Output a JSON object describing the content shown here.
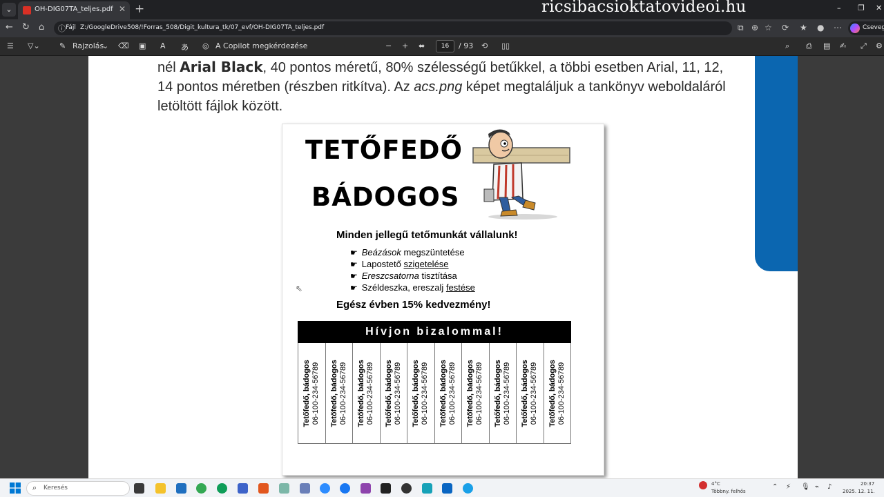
{
  "browser": {
    "tab_title": "OH-DIG07TA_teljes.pdf",
    "watermark": "ricsibacsioktatovideoi.hu",
    "url_scheme": "Fájl",
    "url_path": "Z:/GoogleDrive508/!Forras_508/Digit_kultura_tk/07_evf/OH-DIG07TA_teljes.pdf",
    "copilot_label": "Csevegés"
  },
  "pdf_toolbar": {
    "draw_label": "Rajzolás",
    "ask_copilot_label": "A Copilot megkérdezése",
    "page_current": "16",
    "page_total": "/ 93"
  },
  "document": {
    "para_lead": "nél ",
    "para_bold": "Arial Black",
    "para_mid": ", 40 pontos méretű, 80% szélességű betűkkel, a többi esetben Arial, 11, 12, 14 pontos méretben (részben ritkítva). Az ",
    "para_italic": "acs.png",
    "para_tail": " képet megtaláljuk a tankönyv weboldaláról letöltött fájlok között."
  },
  "flyer": {
    "title_line1": "TETŐFEDŐ",
    "title_line2": "BÁDOGOS",
    "headline": "Minden jellegű tetőmunkát vállalunk!",
    "bullet_glyph": "☛",
    "bullets": [
      {
        "a": "Beázások",
        "b": " megszüntetése"
      },
      {
        "a": "Lapostető ",
        "b": "szigetelése"
      },
      {
        "a": "Ereszcsatorna",
        "b": " tisztítása"
      },
      {
        "a": "Széldeszka, ereszalj ",
        "b": "festése"
      }
    ],
    "discount": "Egész évben 15% kedvezmény!",
    "call_bar": "Hívjon bizalommal!",
    "strip_name": "Tetőfedő, bádogos",
    "strip_phone": "06-100-234-56789"
  },
  "taskbar": {
    "search_placeholder": "Keresés",
    "weather_temp": "4°C",
    "weather_desc": "Több­ny. felhős",
    "clock_time": "20:37",
    "clock_date": "2025. 12. 11."
  }
}
